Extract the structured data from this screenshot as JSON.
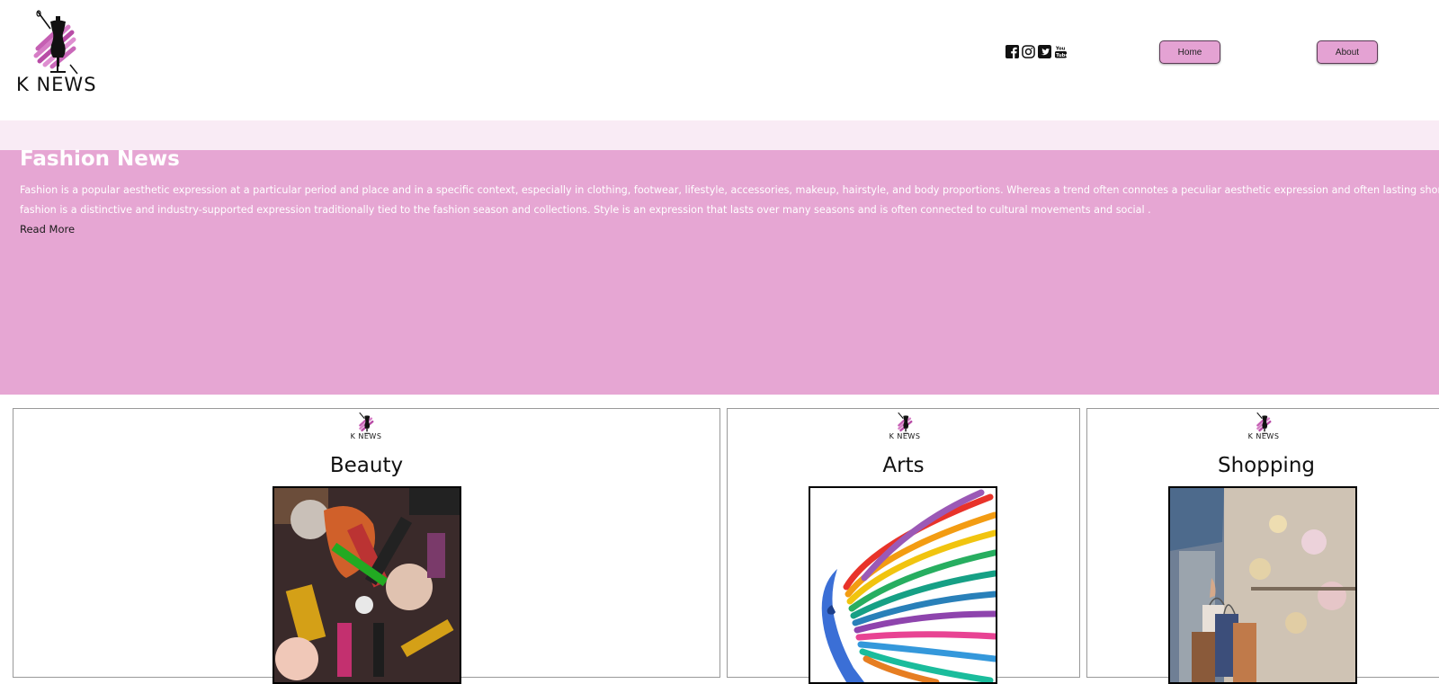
{
  "header": {
    "brand": "K NEWS",
    "social_icons": [
      "facebook-icon",
      "instagram-icon",
      "twitter-icon",
      "youtube-icon"
    ],
    "nav": {
      "home_label": "Home",
      "about_label": "About"
    }
  },
  "hero": {
    "title": "Fashion News",
    "body_lines": [
      "Fashion is a popular aesthetic expression at a particular period and place and in a specific context, especially in clothing, footwear, lifestyle, accessories, makeup, hairstyle, and body proportions. Whereas a trend often connotes a peculiar aesthetic expression and often lasting shorter than a season,",
      "fashion is a distinctive and industry-supported expression traditionally tied to the fashion season and collections. Style is an expression that lasts over many seasons and is often connected to cultural movements and social ."
    ],
    "read_more": "Read More"
  },
  "cards": [
    {
      "brand": "K NEWS",
      "title": "Beauty"
    },
    {
      "brand": "K NEWS",
      "title": "Arts"
    },
    {
      "brand": "K NEWS",
      "title": "Shopping"
    }
  ],
  "colors": {
    "accent_pink": "#e6a6d3",
    "light_pink": "#f9ebf5",
    "button_pink": "#e4a2d3"
  }
}
